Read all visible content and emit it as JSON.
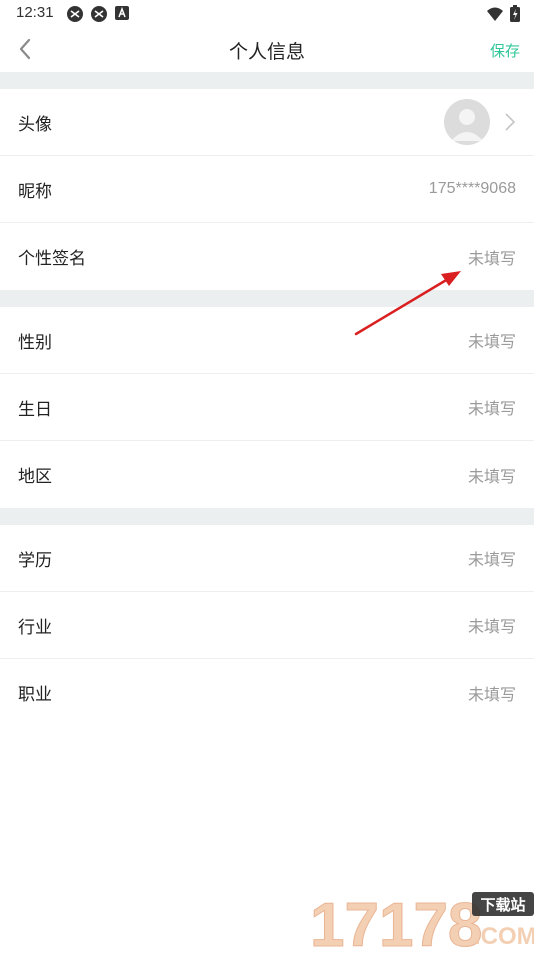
{
  "status_bar": {
    "time": "12:31"
  },
  "nav": {
    "title": "个人信息",
    "save_label": "保存"
  },
  "rows": {
    "avatar": {
      "label": "头像"
    },
    "nickname": {
      "label": "昵称",
      "value": "175****9068"
    },
    "signature": {
      "label": "个性签名",
      "value": "未填写"
    },
    "gender": {
      "label": "性别",
      "value": "未填写"
    },
    "birthday": {
      "label": "生日",
      "value": "未填写"
    },
    "region": {
      "label": "地区",
      "value": "未填写"
    },
    "education": {
      "label": "学历",
      "value": "未填写"
    },
    "industry": {
      "label": "行业",
      "value": "未填写"
    },
    "occupation": {
      "label": "职业",
      "value": "未填写"
    }
  },
  "watermark": {
    "text": "17178",
    "badge": "下载站",
    "suffix": ".COM"
  },
  "colors": {
    "accent": "#2fc79a",
    "annotation_arrow": "#d91f1f",
    "section_gap": "#eceff0"
  }
}
